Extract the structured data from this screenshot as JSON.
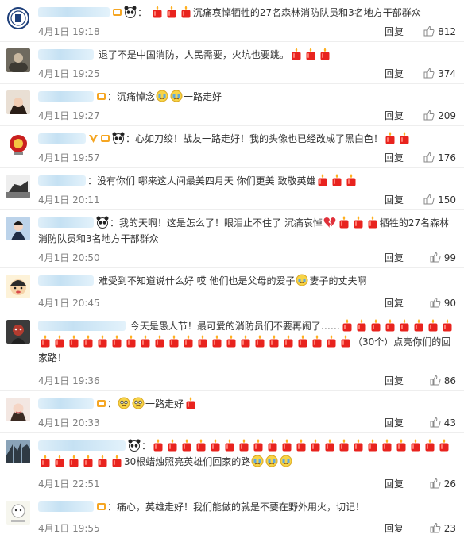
{
  "reply_label": "回复",
  "comments": [
    {
      "prefix": "：",
      "text": "沉痛哀悼牺牲的27名森林消防队员和3名地方干部群众",
      "time": "4月1日 19:18",
      "likes": "812"
    },
    {
      "text": "退了不是中国消防，人民需要，火坑也要跳。",
      "time": "4月1日 19:25",
      "likes": "374"
    },
    {
      "prefix": "：",
      "text": "沉痛悼念",
      "text2": "一路走好",
      "time": "4月1日 19:27",
      "likes": "209"
    },
    {
      "prefix": "：",
      "text": "心如刀绞！战友一路走好！我的头像也已经改成了黑白色！",
      "time": "4月1日 19:57",
      "likes": "176"
    },
    {
      "prefix": "：",
      "text": "没有你们 哪来这人间最美四月天  你们更美 致敬英雄",
      "time": "4月1日 20:11",
      "likes": "150"
    },
    {
      "prefix": "：",
      "text": "我的天啊！这是怎么了！眼泪止不住了 沉痛哀悼",
      "text2": "牺牲的27名森林消防队员和3名地方干部群众",
      "time": "4月1日 20:50",
      "likes": "99"
    },
    {
      "text": "难受到不知道说什么好 哎 他们也是父母的爱子",
      "text2": "妻子的丈夫啊",
      "time": "4月1日 20:45",
      "likes": "90"
    },
    {
      "text": "今天是愚人节！最可爱的消防员们不要再闹了……",
      "text2": "（30个）点亮你们的回家路！",
      "time": "4月1日 19:36",
      "likes": "86"
    },
    {
      "prefix": "：",
      "text": "一路走好",
      "time": "4月1日 20:33",
      "likes": "43"
    },
    {
      "prefix": "：",
      "text": "30根蜡烛照亮英雄们回家的路",
      "time": "4月1日 22:51",
      "likes": "26"
    },
    {
      "prefix": "：",
      "text": "痛心，英雄走好！我们能做的就是不要在野外用火，切记！",
      "time": "4月1日 19:55",
      "likes": "23"
    }
  ]
}
